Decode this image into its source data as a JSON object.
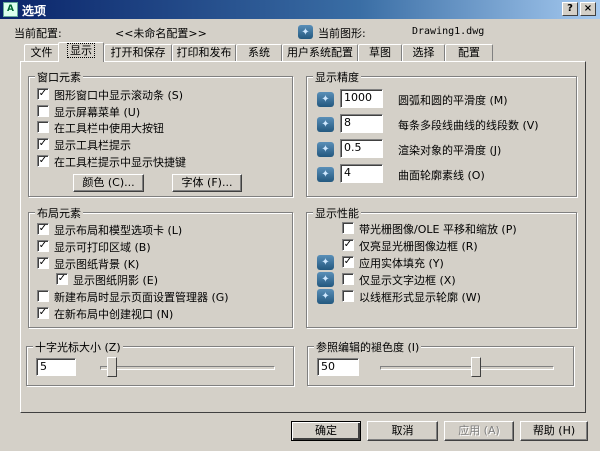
{
  "window": {
    "title": "选项",
    "help_label": "?",
    "close_label": "×"
  },
  "header": {
    "profile_label": "当前配置:",
    "profile_value": "<<未命名配置>>",
    "drawing_label": "当前图形:",
    "drawing_value": "Drawing1.dwg"
  },
  "tabs": [
    {
      "label": "文件"
    },
    {
      "label": "显示"
    },
    {
      "label": "打开和保存"
    },
    {
      "label": "打印和发布"
    },
    {
      "label": "系统"
    },
    {
      "label": "用户系统配置"
    },
    {
      "label": "草图"
    },
    {
      "label": "选择"
    },
    {
      "label": "配置"
    }
  ],
  "active_tab": "显示",
  "window_elements": {
    "title": "窗口元素",
    "items": [
      {
        "label": "图形窗口中显示滚动条 (S)",
        "checked": true
      },
      {
        "label": "显示屏幕菜单 (U)",
        "checked": false
      },
      {
        "label": "在工具栏中使用大按钮",
        "checked": false
      },
      {
        "label": "显示工具栏提示",
        "checked": true
      },
      {
        "label": "在工具栏提示中显示快捷键",
        "checked": true
      }
    ],
    "colors_button": "颜色 (C)...",
    "fonts_button": "字体 (F)..."
  },
  "display_resolution": {
    "title": "显示精度",
    "rows": [
      {
        "value": "1000",
        "label": "圆弧和圆的平滑度 (M)"
      },
      {
        "value": "8",
        "label": "每条多段线曲线的线段数 (V)"
      },
      {
        "value": "0.5",
        "label": "渲染对象的平滑度 (J)"
      },
      {
        "value": "4",
        "label": "曲面轮廓素线 (O)"
      }
    ]
  },
  "layout_elements": {
    "title": "布局元素",
    "items": [
      {
        "label": "显示布局和模型选项卡 (L)",
        "checked": true
      },
      {
        "label": "显示可打印区域 (B)",
        "checked": true
      },
      {
        "label": "显示图纸背景 (K)",
        "checked": true
      },
      {
        "label": "显示图纸阴影 (E)",
        "checked": true
      },
      {
        "label": "新建布局时显示页面设置管理器 (G)",
        "checked": false
      },
      {
        "label": "在新布局中创建视口 (N)",
        "checked": true
      }
    ]
  },
  "display_performance": {
    "title": "显示性能",
    "items": [
      {
        "label": "带光栅图像/OLE 平移和缩放 (P)",
        "checked": false
      },
      {
        "label": "仅亮显光栅图像边框 (R)",
        "checked": true
      },
      {
        "label": "应用实体填充 (Y)",
        "checked": true
      },
      {
        "label": "仅显示文字边框 (X)",
        "checked": false
      },
      {
        "label": "以线框形式显示轮廓 (W)",
        "checked": false
      }
    ]
  },
  "crosshair": {
    "title": "十字光标大小 (Z)",
    "value": "5",
    "slider_percent": 5
  },
  "xref_fade": {
    "title": "参照编辑的褪色度 (I)",
    "value": "50",
    "slider_percent": 50
  },
  "footer": {
    "ok": "确定",
    "cancel": "取消",
    "apply": "应用 (A)",
    "help": "帮助 (H)"
  }
}
